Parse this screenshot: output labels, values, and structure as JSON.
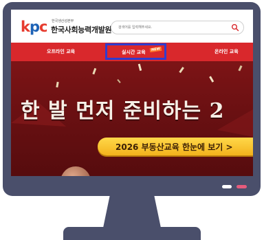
{
  "brand": {
    "logo_mark": "kpc",
    "org_sub": "한국생산성본부",
    "org_name": "한국사회능력개발원"
  },
  "search": {
    "placeholder": "검색어를 입력해주세요.",
    "icon": "search-icon"
  },
  "nav": {
    "items": [
      {
        "label": "오프라인 교육"
      },
      {
        "label": "실시간 교육",
        "badge": "NEW",
        "highlighted": true
      },
      {
        "label": "온라인 교육"
      }
    ]
  },
  "banner": {
    "title": "한 발 먼저 준비하는 2",
    "cta_label": "2026 부동산교육 한눈에 보기 >"
  },
  "colors": {
    "nav_bg": "#d9282c",
    "highlight_border": "#2f3ccf",
    "monitor": "#4a4f6b",
    "cta": "#f3b21c"
  }
}
